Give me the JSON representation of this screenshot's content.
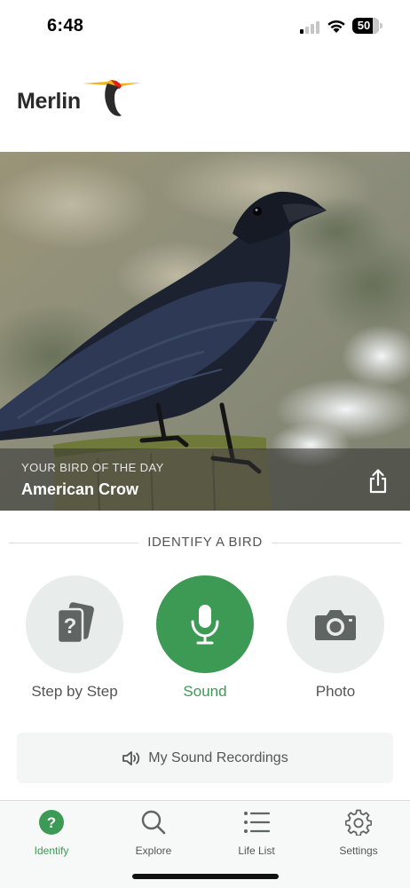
{
  "status_bar": {
    "time": "6:48",
    "battery": "50"
  },
  "header": {
    "logo_text": "Merlin"
  },
  "hero": {
    "kicker": "YOUR BIRD OF THE DAY",
    "bird_name": "American Crow"
  },
  "identify": {
    "section_title": "IDENTIFY A BIRD",
    "modes": [
      {
        "label": "Step by Step",
        "icon": "question-cards-icon",
        "active": false
      },
      {
        "label": "Sound",
        "icon": "microphone-icon",
        "active": true
      },
      {
        "label": "Photo",
        "icon": "camera-icon",
        "active": false
      }
    ],
    "recordings_label": "My Sound Recordings"
  },
  "tabbar": {
    "tabs": [
      {
        "label": "Identify",
        "icon": "question-circle-icon",
        "active": true
      },
      {
        "label": "Explore",
        "icon": "search-icon",
        "active": false
      },
      {
        "label": "Life List",
        "icon": "list-icon",
        "active": false
      },
      {
        "label": "Settings",
        "icon": "gear-icon",
        "active": false
      }
    ]
  },
  "colors": {
    "accent": "#3d9a55",
    "icon_gray": "#5f6563",
    "circle_bg": "#e8ecea"
  }
}
